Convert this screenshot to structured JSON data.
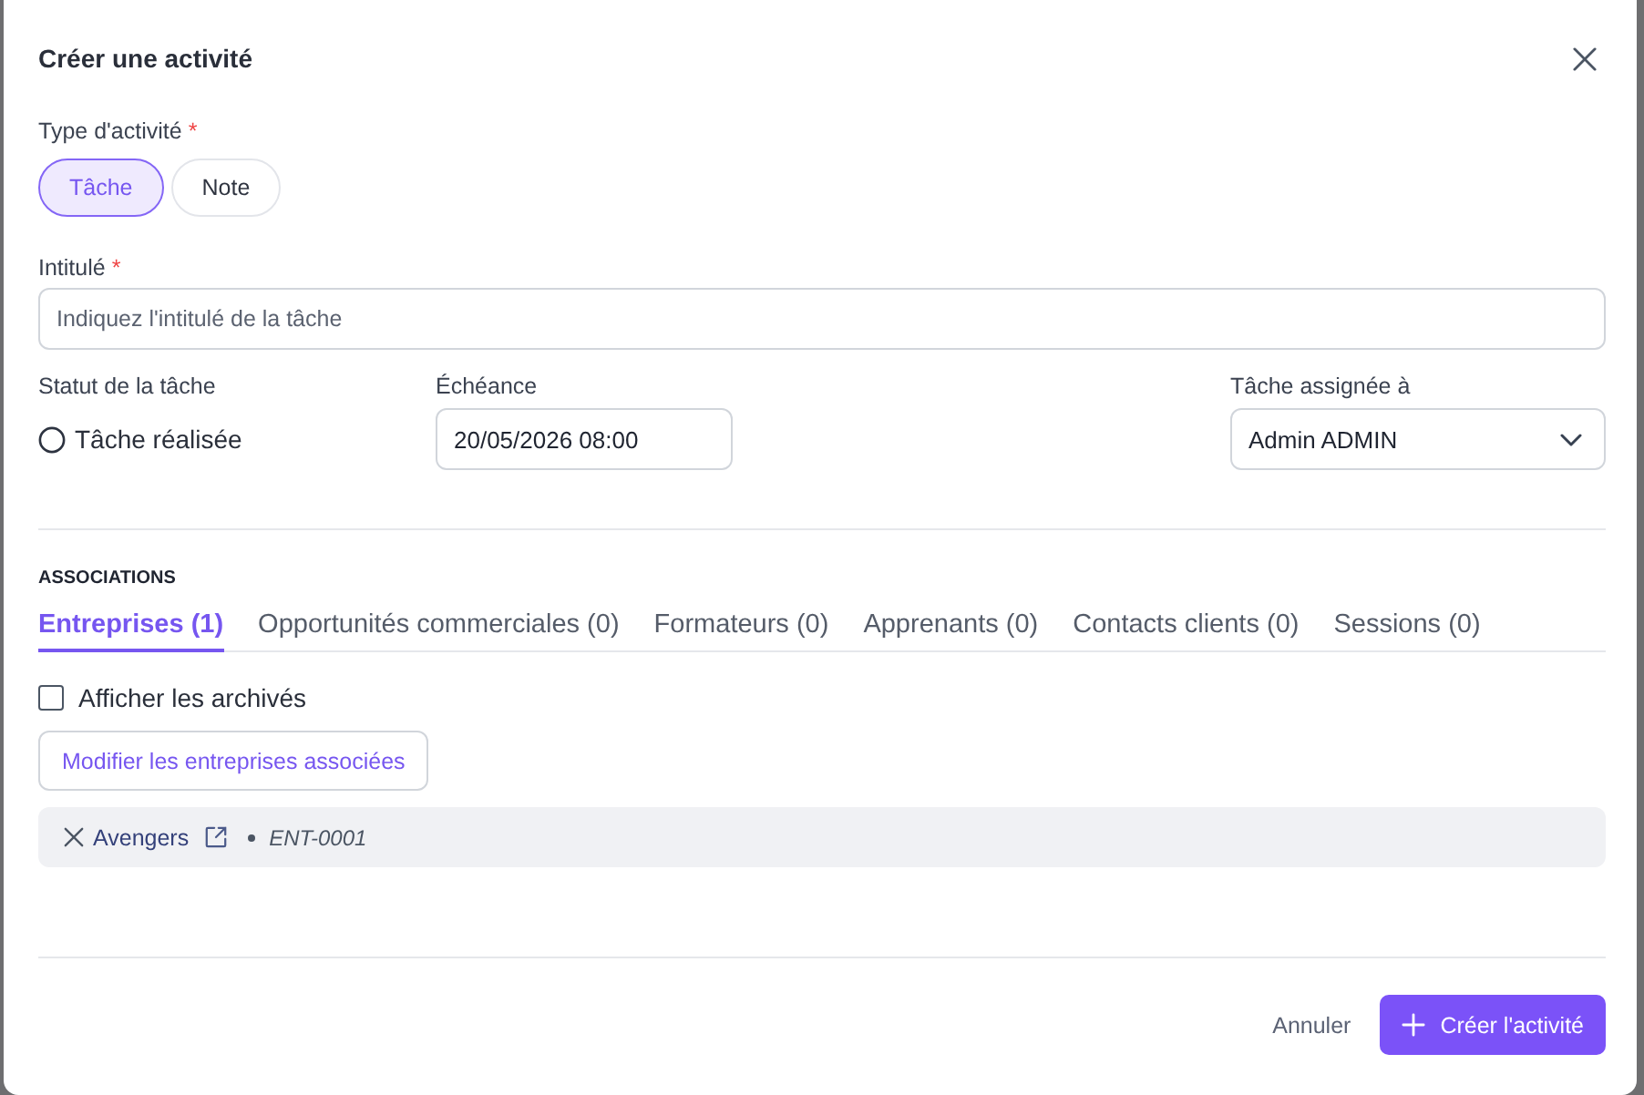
{
  "dialog": {
    "title": "Créer une activité"
  },
  "activity_type": {
    "label": "Type d'activité",
    "required_mark": "*",
    "options": [
      {
        "label": "Tâche",
        "selected": true
      },
      {
        "label": "Note",
        "selected": false
      }
    ]
  },
  "title_field": {
    "label": "Intitulé",
    "required_mark": "*",
    "placeholder": "Indiquez l'intitulé de la tâche"
  },
  "status": {
    "label": "Statut de la tâche",
    "option": {
      "label": "Tâche réalisée",
      "checked": false
    }
  },
  "due_date": {
    "label": "Échéance",
    "value": "20/05/2026 08:00"
  },
  "assignee": {
    "label": "Tâche assignée à",
    "value": "Admin ADMIN"
  },
  "associations": {
    "heading": "ASSOCIATIONS",
    "tabs": [
      {
        "label": "Entreprises (1)",
        "selected": true
      },
      {
        "label": "Opportunités commerciales (0)",
        "selected": false
      },
      {
        "label": "Formateurs (0)",
        "selected": false
      },
      {
        "label": "Apprenants (0)",
        "selected": false
      },
      {
        "label": "Contacts clients (0)",
        "selected": false
      },
      {
        "label": "Sessions (0)",
        "selected": false
      }
    ],
    "show_archived": {
      "label": "Afficher les archivés",
      "checked": false
    },
    "edit_button": "Modifier les entreprises associées",
    "items": [
      {
        "name": "Avengers",
        "code": "ENT-0001"
      }
    ]
  },
  "footer": {
    "cancel": "Annuler",
    "submit": "Créer l'activité"
  }
}
